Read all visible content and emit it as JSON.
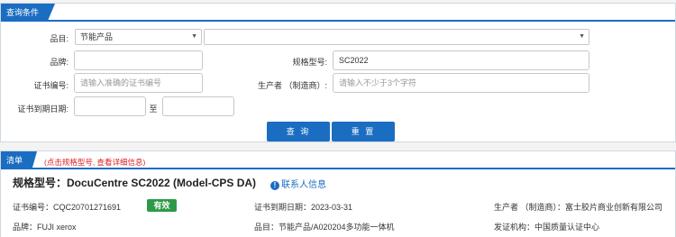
{
  "query_panel": {
    "tab_label": "查询条件",
    "category": {
      "label": "品目:",
      "selected": "节能产品",
      "sub_selected": ""
    },
    "brand": {
      "label": "品牌:",
      "value": ""
    },
    "model": {
      "label": "规格型号:",
      "value": "SC2022"
    },
    "cert_no": {
      "label": "证书编号:",
      "placeholder": "请输入准确的证书编号"
    },
    "producer": {
      "label": "生产者 （制造商）:",
      "placeholder": "请输入不少于3个字符"
    },
    "expiry": {
      "label": "证书到期日期:",
      "to": "至",
      "from_value": "",
      "to_value": ""
    },
    "search_label": "查 询",
    "reset_label": "重 置"
  },
  "list_panel": {
    "tab_label": "清单",
    "note": "(点击规格型号, 查看详细信息)",
    "item": {
      "title": "规格型号：DocuCentre SC2022 (Model-CPS DA)",
      "contact_icon": "info-icon",
      "contact_label": "联系人信息",
      "cert_no": "证书编号：CQC20701271691",
      "status": "有效",
      "expiry": "证书到期日期：2023-03-31",
      "producer": "生产者 （制造商）：富士胶片商业创新有限公司",
      "brand": "品牌：FUJI xerox",
      "category": "品目：节能产品/A020204多功能一体机",
      "issuer": "发证机构：中国质量认证中心"
    }
  },
  "colors": {
    "accent": "#1b6dc1",
    "valid": "#2e9a47",
    "note": "#e02020"
  }
}
